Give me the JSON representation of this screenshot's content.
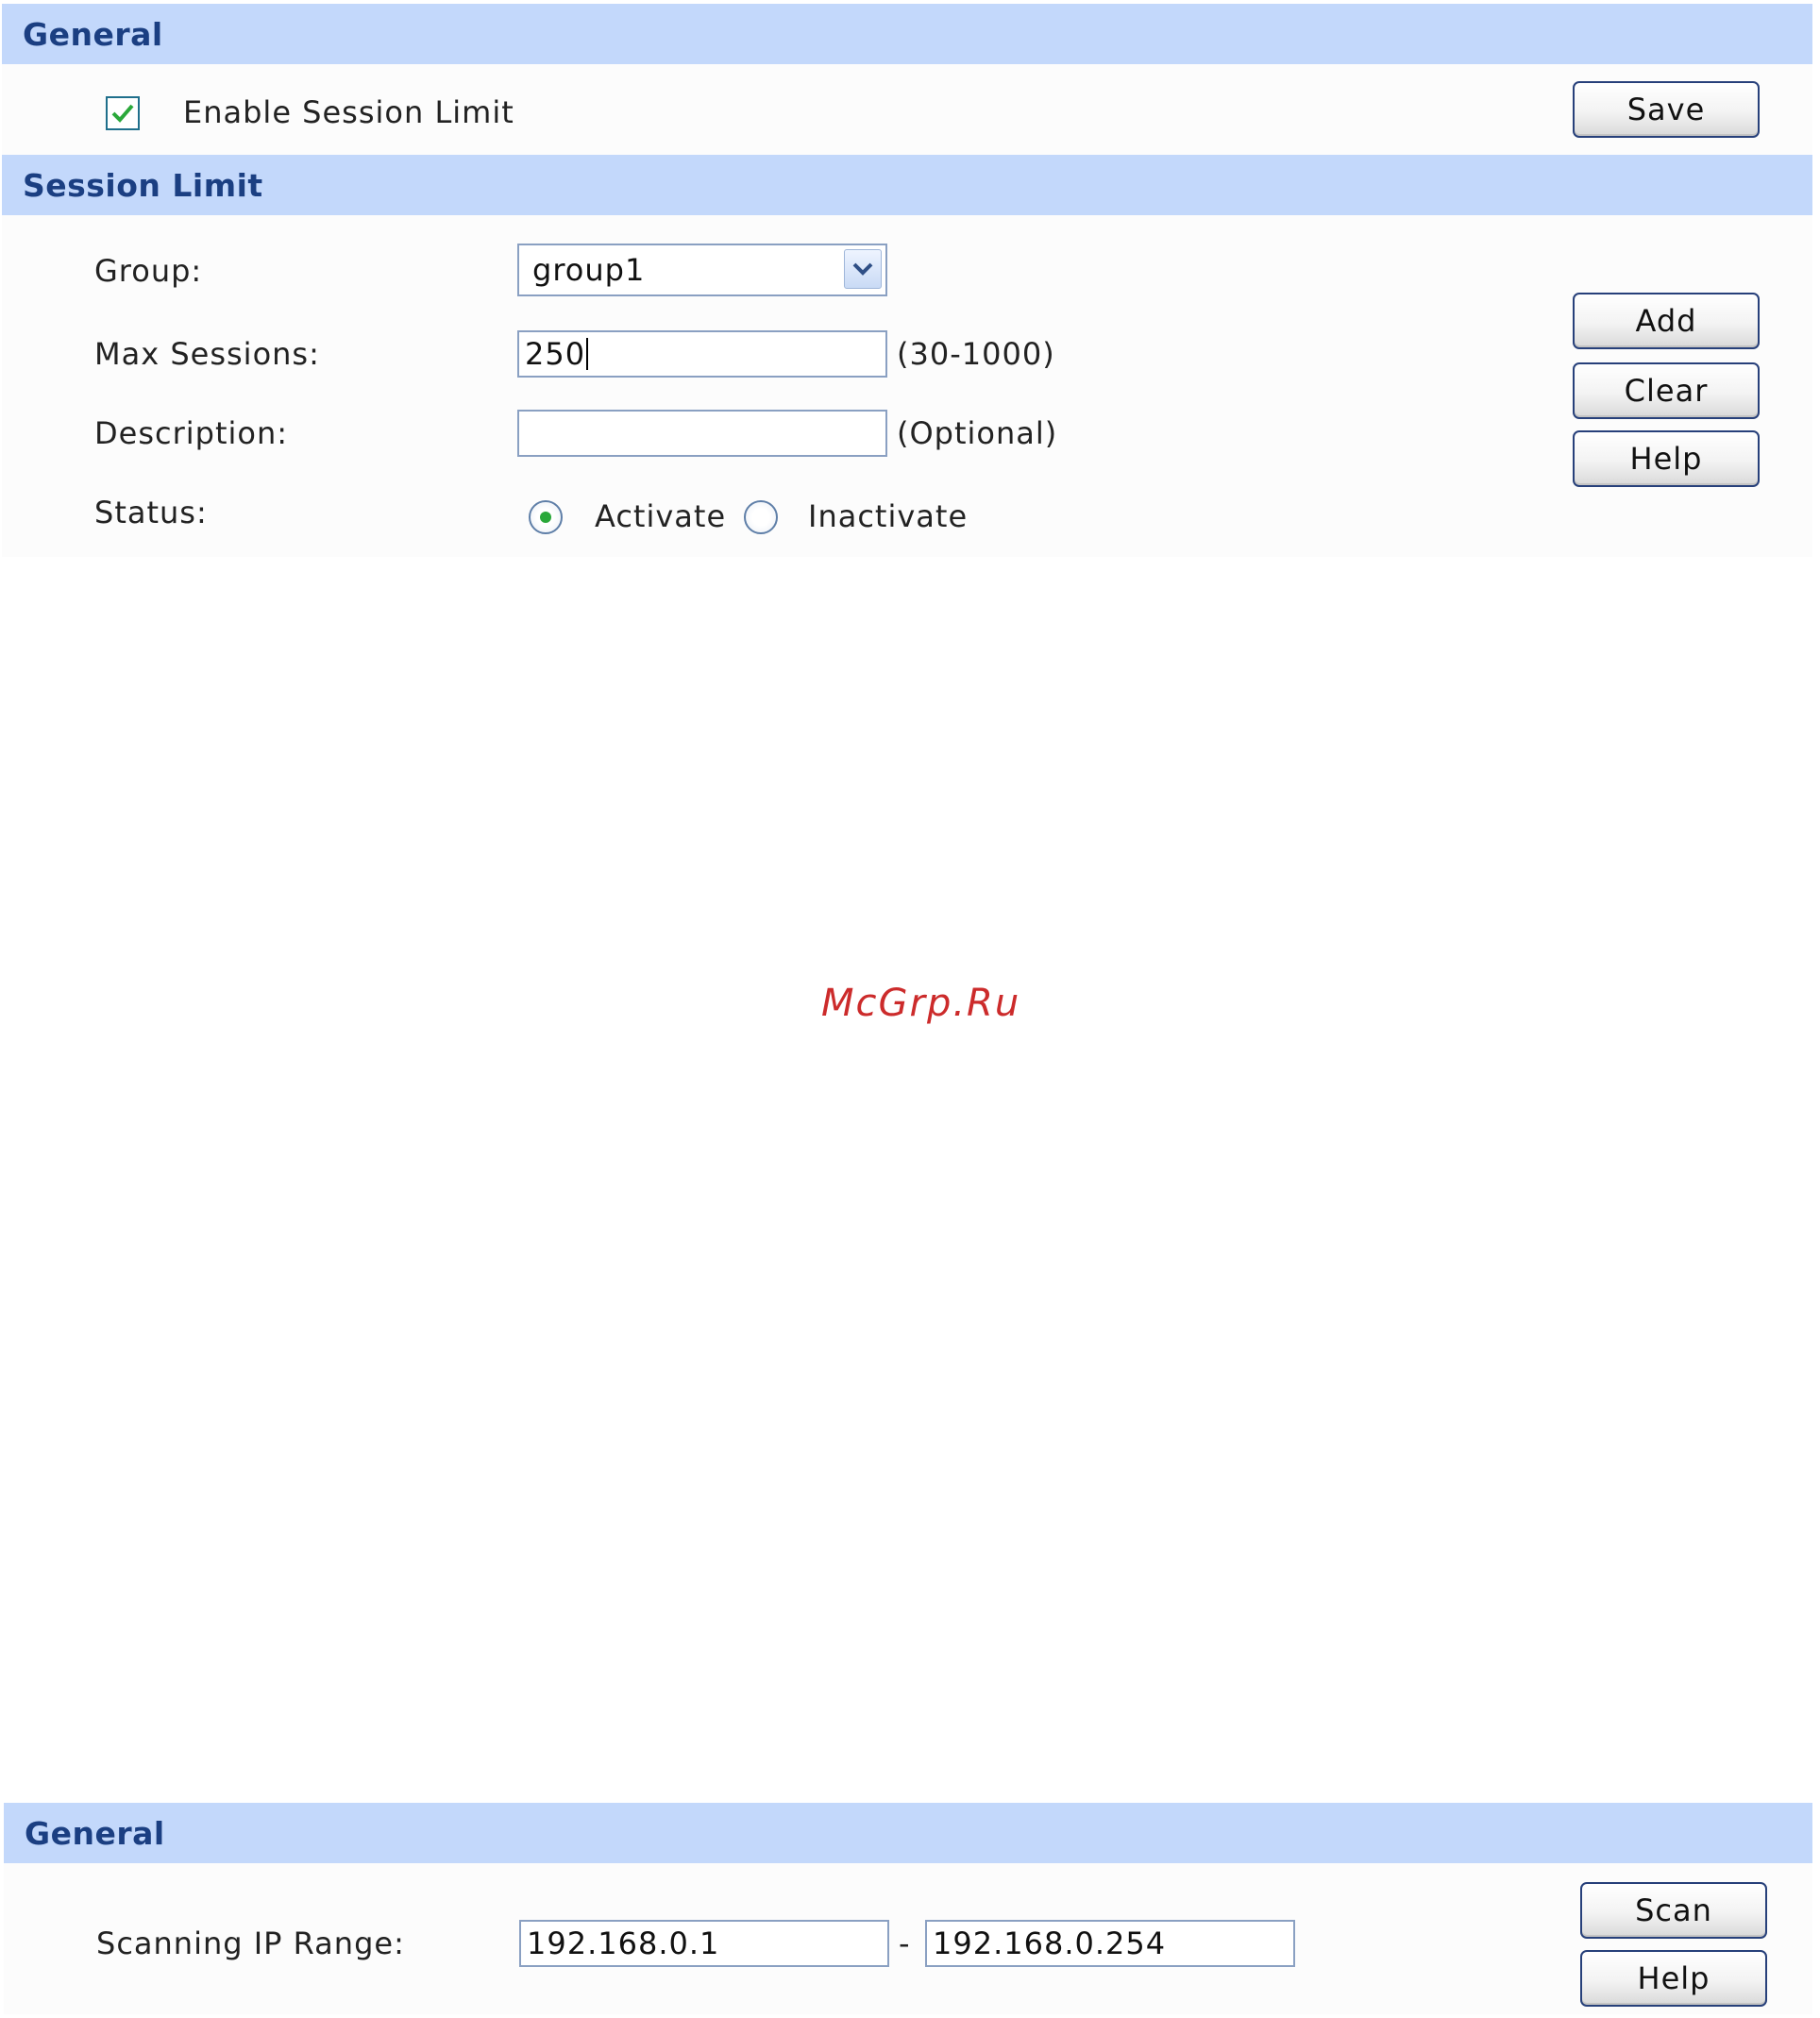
{
  "session_general": {
    "header": "General",
    "enable_label": "Enable Session Limit",
    "enable_checked": true,
    "save_label": "Save"
  },
  "session_limit": {
    "header": "Session Limit",
    "group_label": "Group:",
    "group_value": "group1",
    "max_sessions_label": "Max Sessions:",
    "max_sessions_value": "250",
    "max_sessions_hint": "(30-1000)",
    "description_label": "Description:",
    "description_value": "",
    "description_hint": "(Optional)",
    "status_label": "Status:",
    "status_options": [
      "Activate",
      "Inactivate"
    ],
    "status_selected": "Activate",
    "add_label": "Add",
    "clear_label": "Clear",
    "help_label": "Help"
  },
  "watermark": "McGrp.Ru",
  "scan_general": {
    "header": "General",
    "range_label": "Scanning IP Range:",
    "range_start": "192.168.0.1",
    "range_separator": "-",
    "range_end": "192.168.0.254",
    "scan_label": "Scan",
    "help_label": "Help"
  },
  "colors": {
    "header_bg": "#c3d8fb",
    "header_text": "#1b3f82",
    "button_border": "#27407a",
    "radio_selected": "#2aa83a",
    "check_mark": "#2aa83a",
    "watermark": "#cc2b2b"
  }
}
